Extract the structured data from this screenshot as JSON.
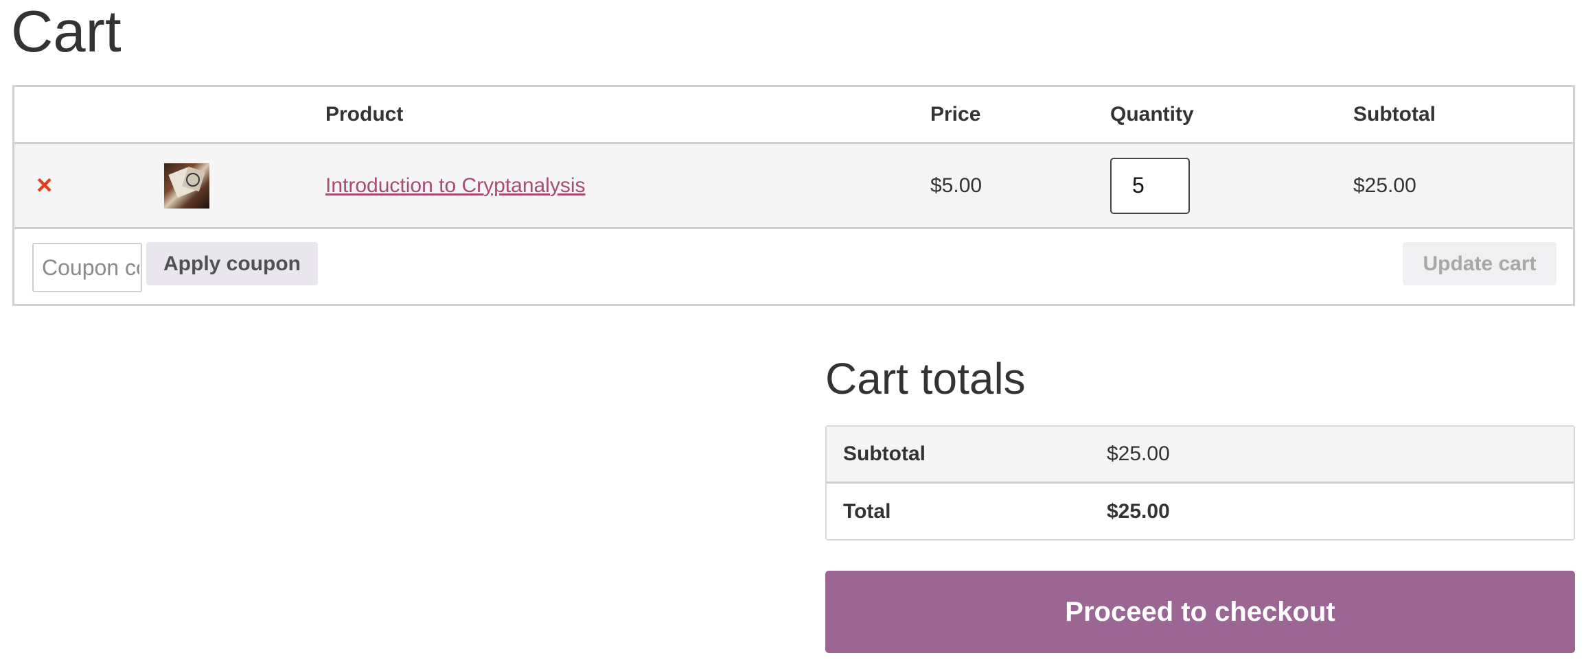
{
  "page": {
    "title": "Cart"
  },
  "cart_table": {
    "headers": {
      "remove": "",
      "thumbnail": "",
      "product": "Product",
      "price": "Price",
      "quantity": "Quantity",
      "subtotal": "Subtotal"
    },
    "items": [
      {
        "remove_icon": "×",
        "product": "Introduction to Cryptanalysis",
        "price": "$5.00",
        "quantity": "5",
        "subtotal": "$25.00"
      }
    ]
  },
  "coupon": {
    "placeholder": "Coupon code",
    "apply_label": "Apply coupon"
  },
  "update_cart_label": "Update cart",
  "totals": {
    "title": "Cart totals",
    "subtotal_label": "Subtotal",
    "subtotal_value": "$25.00",
    "total_label": "Total",
    "total_value": "$25.00"
  },
  "checkout_label": "Proceed to checkout",
  "colors": {
    "link": "#a84b75",
    "remove": "#e2401c",
    "checkout": "#9b6694"
  }
}
